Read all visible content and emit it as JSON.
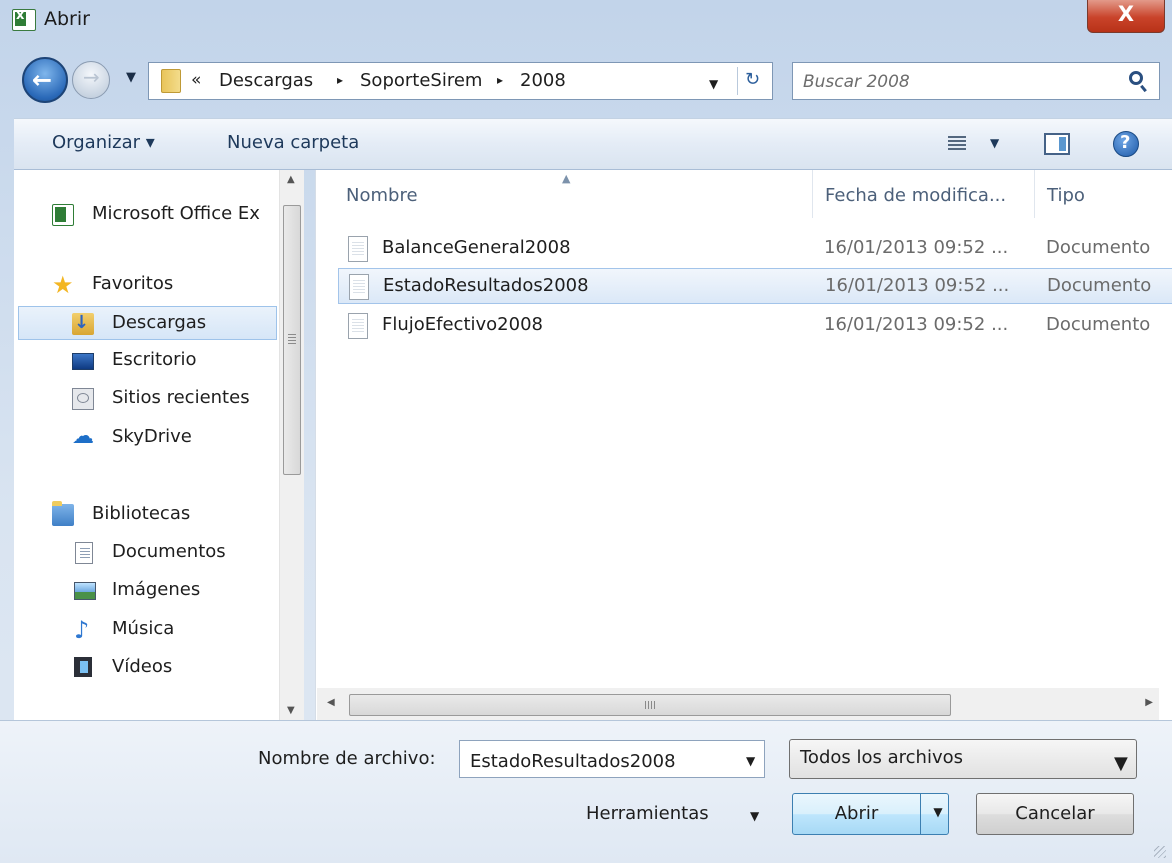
{
  "window": {
    "title": "Abrir",
    "close_glyph": "X"
  },
  "address_bar": {
    "chevron": "«",
    "crumbs": [
      "Descargas",
      "SoporteSirem",
      "2008"
    ],
    "separator": "▸"
  },
  "search": {
    "placeholder": "Buscar 2008"
  },
  "toolbar": {
    "organize_label": "Organizar ▾",
    "new_folder_label": "Nueva carpeta"
  },
  "nav_pane": {
    "items": [
      {
        "label": "Microsoft Office Ex",
        "icon": "excel-icon"
      },
      {
        "label": "Favoritos",
        "icon": "star-icon"
      },
      {
        "label": "Descargas",
        "icon": "downloads-folder-icon"
      },
      {
        "label": "Escritorio",
        "icon": "desktop-icon"
      },
      {
        "label": "Sitios recientes",
        "icon": "recent-places-icon"
      },
      {
        "label": "SkyDrive",
        "icon": "skydrive-cloud-icon"
      },
      {
        "label": "Bibliotecas",
        "icon": "libraries-icon"
      },
      {
        "label": "Documentos",
        "icon": "documents-icon"
      },
      {
        "label": "Imágenes",
        "icon": "pictures-icon"
      },
      {
        "label": "Música",
        "icon": "music-icon"
      },
      {
        "label": "Vídeos",
        "icon": "videos-icon"
      }
    ],
    "selected": "Descargas"
  },
  "file_list": {
    "columns": [
      "Nombre",
      "Fecha de modifica...",
      "Tipo"
    ],
    "rows": [
      {
        "name": "BalanceGeneral2008",
        "date": "16/01/2013 09:52 ...",
        "type": "Documento"
      },
      {
        "name": "EstadoResultados2008",
        "date": "16/01/2013 09:52 ...",
        "type": "Documento"
      },
      {
        "name": "FlujoEfectivo2008",
        "date": "16/01/2013 09:52 ...",
        "type": "Documento"
      }
    ],
    "selected_row": "EstadoResultados2008"
  },
  "bottom": {
    "filename_label": "Nombre de archivo:",
    "filename_value": "EstadoResultados2008",
    "filetype_value": "Todos los archivos",
    "tools_label": "Herramientas",
    "open_label": "Abrir",
    "cancel_label": "Cancelar"
  },
  "colors": {
    "accent": "#3c7fb1",
    "selection": "#dbe8f7",
    "close_button": "#c9432a"
  }
}
